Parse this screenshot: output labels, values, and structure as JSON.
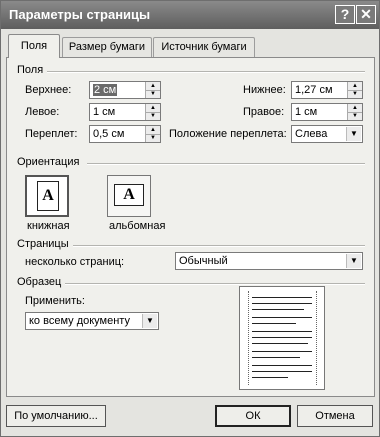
{
  "window": {
    "title": "Параметры страницы",
    "help_glyph": "?",
    "close_glyph": "✕"
  },
  "tabs": [
    "Поля",
    "Размер бумаги",
    "Источник бумаги"
  ],
  "margins": {
    "group_label": "Поля",
    "top": {
      "label": "Верхнее:",
      "value": "2 см"
    },
    "bottom": {
      "label": "Нижнее:",
      "value": "1,27 см"
    },
    "left": {
      "label": "Левое:",
      "value": "1 см"
    },
    "right": {
      "label": "Правое:",
      "value": "1 см"
    },
    "gutter": {
      "label": "Переплет:",
      "value": "0,5 см"
    },
    "gutter_pos": {
      "label": "Положение переплета:",
      "value": "Слева"
    }
  },
  "orientation": {
    "group_label": "Ориентация",
    "portrait": {
      "label": "книжная",
      "glyph": "A"
    },
    "landscape": {
      "label": "альбомная",
      "glyph": "A"
    },
    "selected": "portrait"
  },
  "pages": {
    "group_label": "Страницы",
    "multiple_label": "несколько страниц:",
    "multiple_value": "Обычный"
  },
  "sample": {
    "group_label": "Образец",
    "apply_label": "Применить:",
    "apply_value": "ко всему документу"
  },
  "buttons": {
    "default": "По умолчанию...",
    "ok": "ОК",
    "cancel": "Отмена"
  },
  "icons": {
    "spin_up": "▲",
    "spin_down": "▼",
    "dropdown": "▼"
  }
}
